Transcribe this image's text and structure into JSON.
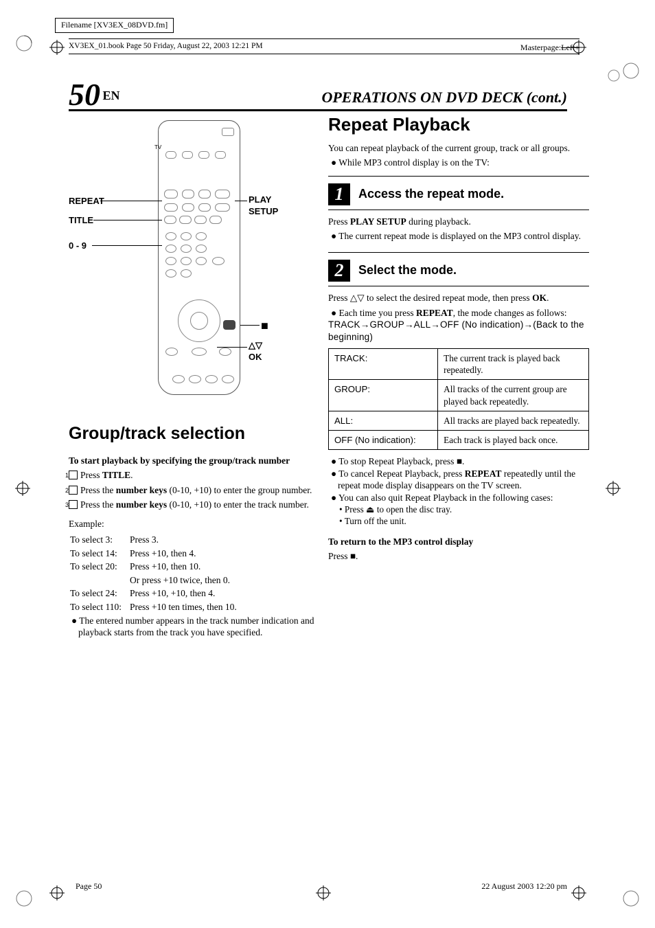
{
  "meta": {
    "filename": "Filename [XV3EX_08DVD.fm]",
    "masterpage_label": "Masterpage:",
    "masterpage_value": "Left+",
    "bookline": "XV3EX_01.book  Page 50  Friday, August 22, 2003  12:21 PM"
  },
  "header": {
    "page_num": "50",
    "lang": "EN",
    "section": "OPERATIONS ON DVD DECK (cont.)"
  },
  "remote_callouts": {
    "repeat": "REPEAT",
    "title": "TITLE",
    "numkeys": "0 - 9",
    "playsetup_l1": "PLAY",
    "playsetup_l2": "SETUP",
    "stop": "■",
    "updown_ok_l1": "△▽",
    "updown_ok_l2": "OK",
    "tv": "TV"
  },
  "left": {
    "heading": "Group/track selection",
    "intro": "To start playback by specifying the group/track number",
    "s1": {
      "n": "1",
      "before": "Press ",
      "bold": "TITLE",
      "after": "."
    },
    "s2": {
      "n": "2",
      "before": "Press the ",
      "bold": "number keys",
      "after": " (0-10, +10) to enter the group number."
    },
    "s3": {
      "n": "3",
      "before": "Press the ",
      "bold": "number keys",
      "after": " (0-10, +10) to enter the track number."
    },
    "example_label": "Example:",
    "examples": [
      [
        "To select 3:",
        "Press 3."
      ],
      [
        "To select 14:",
        "Press +10, then 4."
      ],
      [
        "To select 20:",
        "Press +10, then 10."
      ],
      [
        "",
        "Or press +10 twice, then 0."
      ],
      [
        "To select 24:",
        "Press +10, +10, then 4."
      ],
      [
        "To select 110:",
        "Press +10 ten times, then 10."
      ]
    ],
    "note": "The entered number appears in the track number indication and playback starts from the track you have specified."
  },
  "right": {
    "heading": "Repeat Playback",
    "intro": "You can repeat playback of the current group, track or all groups.",
    "intro_bullet": "While MP3 control display is on the TV:",
    "step1": {
      "num": "1",
      "title": "Access the repeat mode.",
      "p_before": "Press ",
      "p_bold": "PLAY SETUP",
      "p_after": " during playback.",
      "b1": "The current repeat mode is displayed on the MP3 control display."
    },
    "step2": {
      "num": "2",
      "title": "Select the mode.",
      "p1": "Press △▽ to select the desired repeat mode, then press ",
      "p1_bold": "OK",
      "p1_after": ".",
      "b1_before": "Each time you press ",
      "b1_bold": "REPEAT",
      "b1_after": ", the mode changes as follows:",
      "seq": "TRACK→GROUP→ALL→OFF (No indication)→(Back to the beginning)"
    },
    "table": [
      [
        "TRACK:",
        "The current track is played back repeatedly."
      ],
      [
        "GROUP:",
        "All tracks of the current group are played back repeatedly."
      ],
      [
        "ALL:",
        "All tracks are played back repeatedly."
      ],
      [
        "OFF (No indication):",
        "Each track is played back once."
      ]
    ],
    "post": {
      "b1": "To stop Repeat Playback, press ■.",
      "b2_before": "To cancel Repeat Playback, press ",
      "b2_bold": "REPEAT",
      "b2_after": " repeatedly until the repeat mode display disappears on the TV screen.",
      "b3": "You can also quit Repeat Playback in the following cases:",
      "b3_sub1": "Press ⏏ to open the disc tray.",
      "b3_sub2": "Turn off the unit."
    },
    "return": {
      "h": "To return to the MP3 control display",
      "p": "Press ■."
    }
  },
  "footer": {
    "left": "Page 50",
    "right": "22 August 2003 12:20 pm"
  }
}
